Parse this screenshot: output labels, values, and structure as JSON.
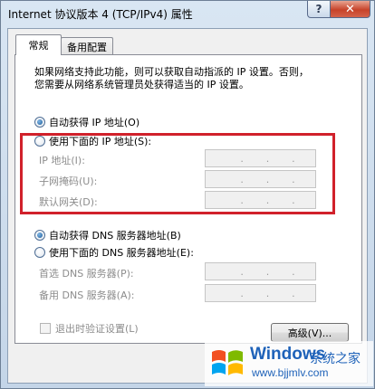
{
  "window": {
    "title": "Internet 协议版本 4 (TCP/IPv4) 属性",
    "help_label": "?",
    "close_label": "✕"
  },
  "tabs": [
    {
      "label": "常规",
      "active": true
    },
    {
      "label": "备用配置",
      "active": false
    }
  ],
  "general": {
    "description_line1": "如果网络支持此功能，则可以获取自动指派的 IP 设置。否则，",
    "description_line2": "您需要从网络系统管理员处获得适当的 IP 设置。",
    "ip": {
      "auto_label": "自动获得 IP 地址(O)",
      "auto_checked": true,
      "manual_label": "使用下面的 IP 地址(S):",
      "manual_checked": false,
      "ip_address_label": "IP 地址(I):",
      "subnet_label": "子网掩码(U):",
      "gateway_label": "默认网关(D):"
    },
    "dns": {
      "auto_label": "自动获得 DNS 服务器地址(B)",
      "auto_checked": true,
      "manual_label": "使用下面的 DNS 服务器地址(E):",
      "manual_checked": false,
      "preferred_label": "首选 DNS 服务器(P):",
      "alternate_label": "备用 DNS 服务器(A):"
    },
    "validate_label": "退出时验证设置(L)",
    "advanced_label": "高级(V)...",
    "ip_separator": "."
  },
  "watermark": {
    "brand": "Windows",
    "brand_sub": "系统之家",
    "url": "www.bjjmlv.com"
  },
  "colors": {
    "highlight": "#d1212b",
    "brand_blue": "#1e62b9"
  }
}
